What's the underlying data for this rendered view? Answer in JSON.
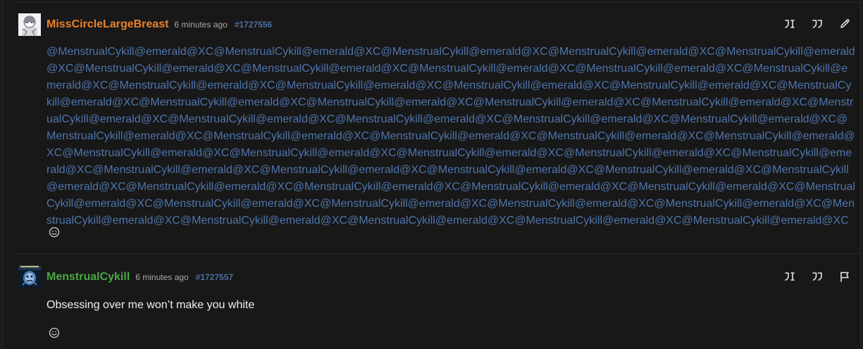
{
  "posts": [
    {
      "username": "MissCircleLargeBreast",
      "username_color": "#e9812b",
      "time": "6 minutes ago",
      "post_id": "#1727556",
      "content": "@MenstrualCykill@emerald@XC@MenstrualCykill@emerald@XC@MenstrualCykill@emerald@XC@MenstrualCykill@emerald@XC@MenstrualCykill@emerald@XC@MenstrualCykill@emerald@XC@MenstrualCykill@emerald@XC@MenstrualCykill@emerald@XC@MenstrualCykill@emerald@XC@MenstrualCykill@emerald@XC@MenstrualCykill@emerald@XC@MenstrualCykill@emerald@XC@MenstrualCykill@emerald@XC@MenstrualCykill@emerald@XC@MenstrualCykill@emerald@XC@MenstrualCykill@emerald@XC@MenstrualCykill@emerald@XC@MenstrualCykill@emerald@XC@MenstrualCykill@emerald@XC@MenstrualCykill@emerald@XC@MenstrualCykill@emerald@XC@MenstrualCykill@emerald@XC@MenstrualCykill@emerald@XC@MenstrualCykill@emerald@XC@MenstrualCykill@emerald@XC@MenstrualCykill@emerald@XC@MenstrualCykill@emerald@XC@MenstrualCykill@emerald@XC@MenstrualCykill@emerald@XC@MenstrualCykill@emerald@XC@MenstrualCykill@emerald@XC@MenstrualCykill@emerald@XC@MenstrualCykill@emerald@XC@MenstrualCykill@emerald@XC@MenstrualCykill@emerald@XC@MenstrualCykill@emerald@XC@MenstrualCykill@emerald@XC@MenstrualCykill@emerald@XC@MenstrualCykill@emerald@XC@MenstrualCykill@emerald@XC@MenstrualCykill@emerald@XC@MenstrualCykill@emerald@XC@MenstrualCykill@emerald@XC@MenstrualCykill@emerald@XC@MenstrualCykill@emerald@XC@MenstrualCykill@emerald@XC@MenstrualCykill@emerald@XC@MenstrualCykill@emerald@XC@MenstrualCykill@emerald@XC@MenstrualCykill@emerald@XC@MenstrualCykill@emerald@XC@MenstrualCykill@emerald@XC@MenstrualCykill@emerald@XC",
      "actions": [
        "reply-icon",
        "quote-icon",
        "edit-icon"
      ],
      "reaction_icon": "smiley-icon"
    },
    {
      "username": "MenstrualCykill",
      "username_color": "#4aa843",
      "time": "6 minutes ago",
      "post_id": "#1727557",
      "content": "Obsessing over me won’t make you white",
      "actions": [
        "reply-icon",
        "quote-icon",
        "flag-icon"
      ],
      "reaction_icon": "smiley-icon"
    }
  ],
  "colors": {
    "background": "#181818",
    "mention_link": "#4e75ac",
    "post_id": "#4d6e9c",
    "timestamp": "#a8a8a8",
    "icon": "#e6e6e6"
  }
}
